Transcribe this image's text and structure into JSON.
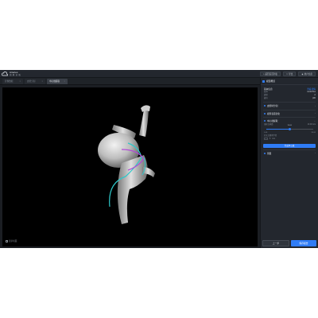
{
  "app": {
    "logo_text": "Arteries",
    "logo_sub": "动 脉 分 析"
  },
  "top_actions": [
    {
      "label": "返回首页列表",
      "icon": "home-icon"
    },
    {
      "label": "导出",
      "icon": "export-icon"
    },
    {
      "label": "用户信息",
      "icon": "user-icon"
    }
  ],
  "tabs": [
    {
      "label": "影像数据",
      "active": false
    },
    {
      "label": "血管分割",
      "active": false
    },
    {
      "label": "中心线提取",
      "active": true
    }
  ],
  "viewport": {
    "footer_label": "显示切面"
  },
  "panel": {
    "title": "模型概览",
    "info": {
      "title": "基本信息",
      "link": "查看详情",
      "rows": [
        {
          "k": "名称",
          "v": "AorticPlus"
        },
        {
          "k": "类型",
          "v": "A"
        },
        {
          "k": "编号",
          "v": "p#0"
        }
      ]
    },
    "sections": [
      {
        "title": "血管树分割"
      },
      {
        "title": "模型表面优化"
      },
      {
        "title": "中心线提取"
      }
    ],
    "centerline": {
      "param_label": "采样点间距",
      "param_value": "10.00",
      "param_unit": "mm",
      "slider_value": 15.0,
      "slider_min": 0.0,
      "slider_max": 30.0,
      "range_min_label": "0.00",
      "range_max_label": "30.00",
      "tip_label": "15.00",
      "option_label": "分叉点搜索半径",
      "option_value": "5",
      "option_unit": "mm",
      "action": "生成中心线"
    },
    "last_section": "测量"
  },
  "footer": {
    "prev": "上一步",
    "next": "保存报告"
  },
  "colors": {
    "accent": "#2f7cf6",
    "background": "#1b1e23",
    "panel": "#23272e",
    "centerline_primary": "#2ec7c9",
    "centerline_secondary": "#b04ad6"
  }
}
